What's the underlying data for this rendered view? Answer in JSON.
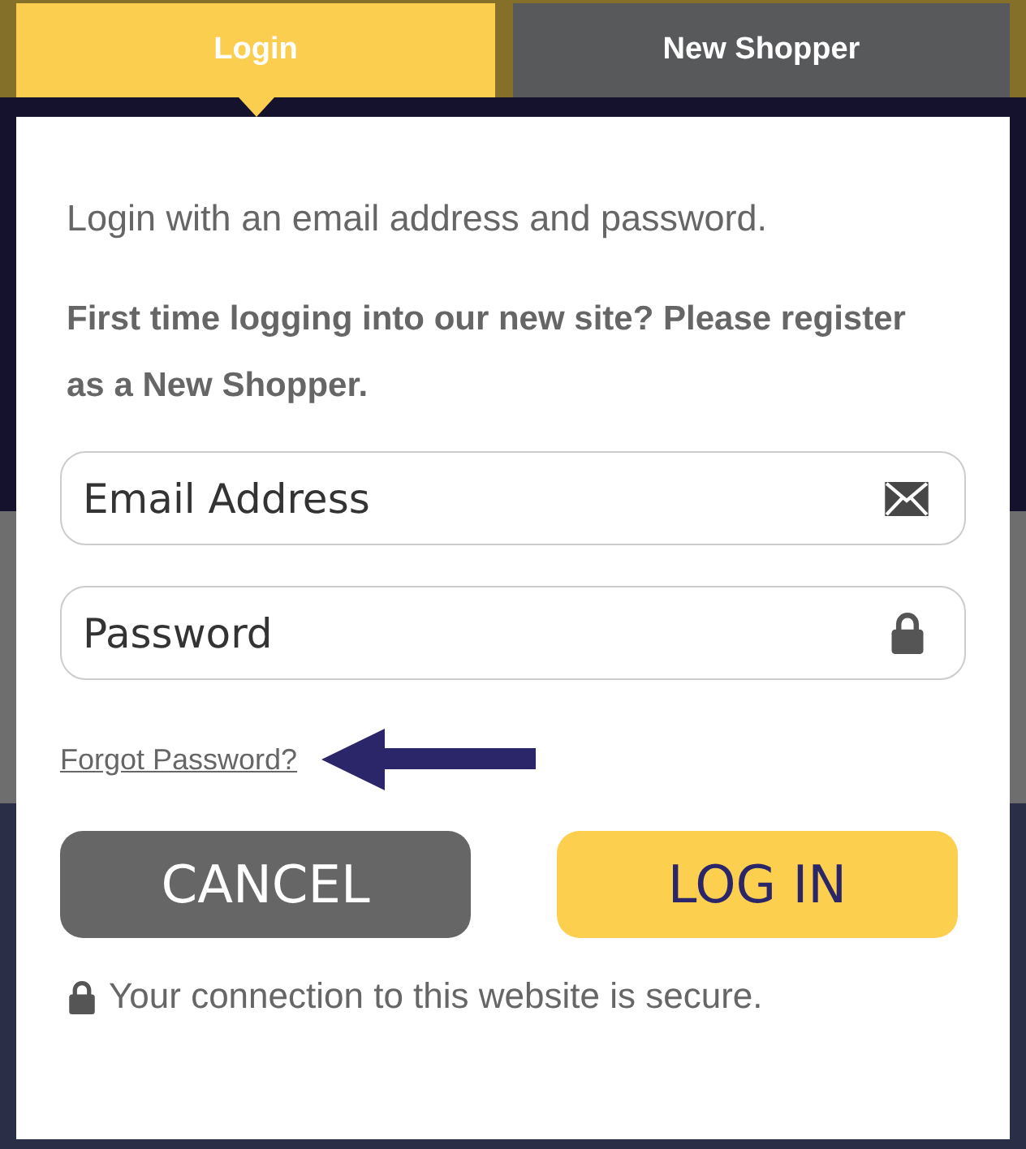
{
  "tabs": [
    {
      "label": "Login",
      "selected": true
    },
    {
      "label": "New Shopper",
      "selected": false
    }
  ],
  "intro": "Login with an email address and password.",
  "notice": "First time logging into our new site? Please register as a New Shopper.",
  "fields": [
    {
      "kind": "email",
      "placeholder": "Email Address"
    },
    {
      "kind": "password",
      "placeholder": "Password"
    }
  ],
  "forgot_link": "Forgot Password?",
  "buttons": [
    {
      "kind": "secondary",
      "label": "CANCEL"
    },
    {
      "kind": "primary",
      "label": "LOG IN"
    }
  ],
  "security_note": "Your connection to this website is secure."
}
